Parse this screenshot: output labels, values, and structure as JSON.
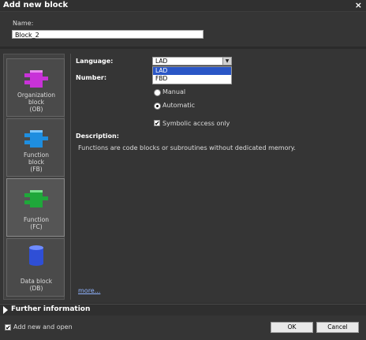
{
  "window": {
    "title": "Add new block",
    "close_glyph": "×"
  },
  "name": {
    "label": "Name:",
    "value": "Block_2"
  },
  "block_types": [
    {
      "label1": "Organization",
      "label2": "block",
      "label3": "(OB)",
      "icon": "organization-block-icon",
      "color": "#c832d8"
    },
    {
      "label1": "Function",
      "label2": "block",
      "label3": "(FB)",
      "icon": "function-block-icon",
      "color": "#1e8ee0"
    },
    {
      "label1": "Function",
      "label2": "(FC)",
      "icon": "function-icon",
      "color": "#1fa83a"
    },
    {
      "label1": "Data block",
      "label2": "(DB)",
      "icon": "data-block-icon",
      "color": "#2f4fd6"
    }
  ],
  "language": {
    "label": "Language:",
    "selected": "LAD",
    "options": [
      "LAD",
      "FBD"
    ],
    "highlighted": "LAD"
  },
  "number": {
    "label": "Number:",
    "manual": "Manual",
    "automatic": "Automatic"
  },
  "symbolic": {
    "label": "Symbolic access only",
    "checked": true
  },
  "description": {
    "label": "Description:",
    "text": "Functions are code blocks or subroutines without dedicated memory."
  },
  "more_link": "more...",
  "further_info": "Further information",
  "footer": {
    "add_new_open": "Add new and open",
    "ok": "OK",
    "cancel": "Cancel"
  }
}
